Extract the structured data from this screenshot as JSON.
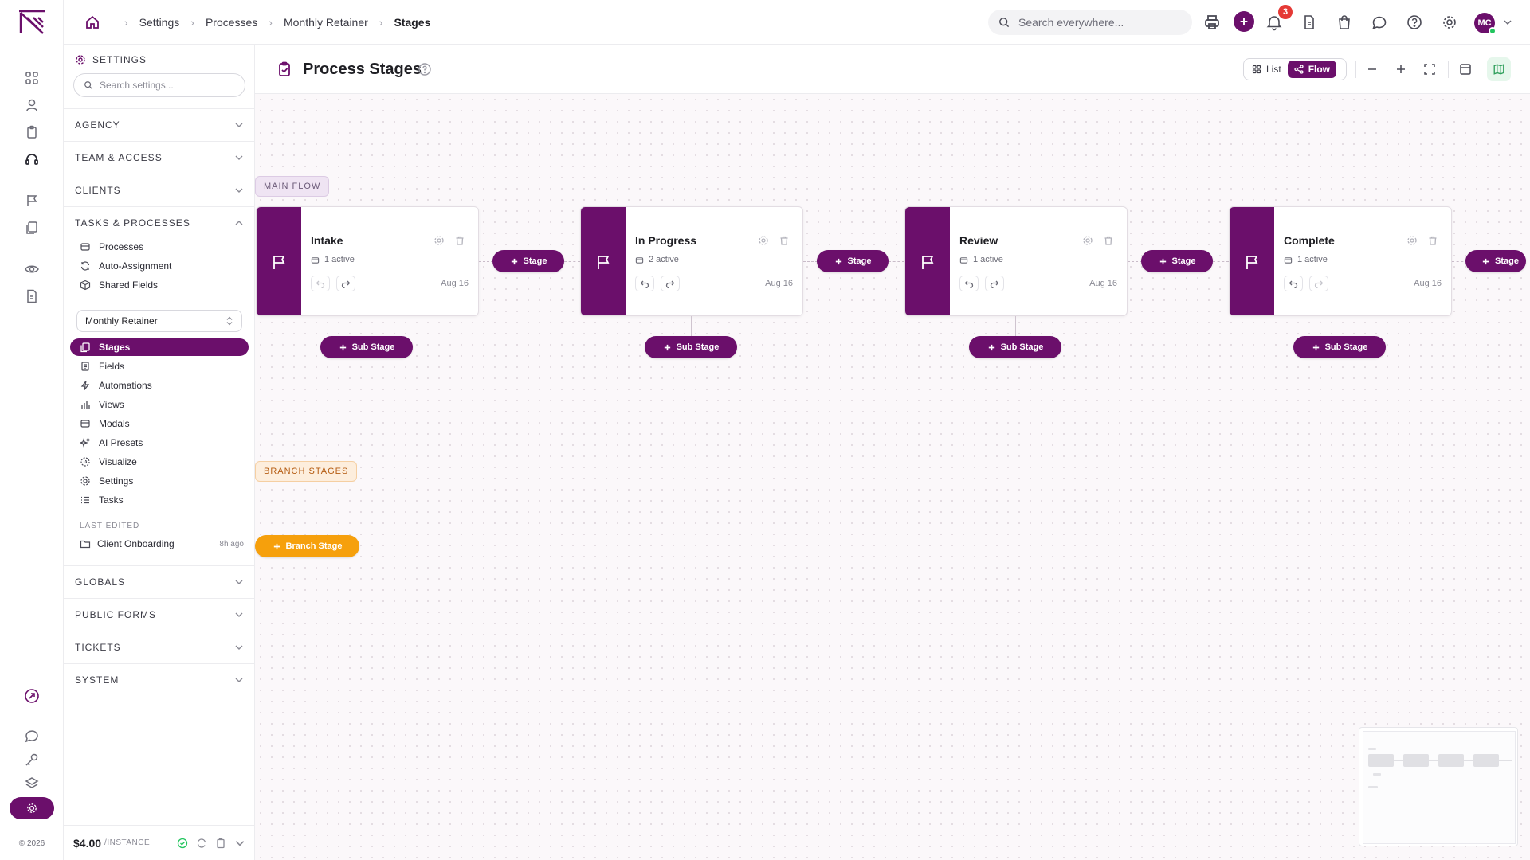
{
  "rail": {
    "copyright": "© 2026",
    "icons": [
      "grid-icon",
      "user-icon",
      "clipboard-icon",
      "headset-icon",
      "flag-icon",
      "process-icon",
      "eye-icon",
      "document-icon",
      "rocket-icon",
      "chat-icon",
      "key-icon",
      "layers-icon",
      "gear-icon"
    ]
  },
  "topbar": {
    "breadcrumb": [
      "Settings",
      "Processes",
      "Monthly Retainer",
      "Stages"
    ],
    "search_placeholder": "Search everywhere...",
    "notification_count": "3",
    "avatar_initials": "MC"
  },
  "sidebar": {
    "heading": "SETTINGS",
    "search_placeholder": "Search settings...",
    "sections_top": [
      "AGENCY",
      "TEAM & ACCESS",
      "CLIENTS"
    ],
    "tasks_section": "TASKS & PROCESSES",
    "tasks_items": [
      "Processes",
      "Auto-Assignment",
      "Shared Fields"
    ],
    "process_select": "Monthly Retainer",
    "process_items": [
      "Stages",
      "Fields",
      "Automations",
      "Views",
      "Modals",
      "AI Presets",
      "Visualize",
      "Settings",
      "Tasks"
    ],
    "last_edited_label": "LAST EDITED",
    "last_edited_item": "Client Onboarding",
    "last_edited_ago": "8h ago",
    "sections_bottom": [
      "GLOBALS",
      "PUBLIC FORMS",
      "TICKETS",
      "SYSTEM"
    ],
    "footer_price": "$4.00",
    "footer_unit": "/INSTANCE"
  },
  "main": {
    "title": "Process Stages",
    "view_list": "List",
    "view_flow": "Flow",
    "active_view": "Flow"
  },
  "canvas": {
    "main_flow_label": "MAIN FLOW",
    "branch_label": "BRANCH STAGES",
    "add_stage_label": "Stage",
    "add_sub_stage_label": "Sub Stage",
    "add_branch_label": "Branch Stage",
    "stages": [
      {
        "name": "Intake",
        "active": "1 active",
        "date": "Aug 16"
      },
      {
        "name": "In Progress",
        "active": "2 active",
        "date": "Aug 16"
      },
      {
        "name": "Review",
        "active": "1 active",
        "date": "Aug 16"
      },
      {
        "name": "Complete",
        "active": "1 active",
        "date": "Aug 16"
      }
    ]
  },
  "colors": {
    "brand": "#6b0f6b",
    "branch": "#f6a00c",
    "badge": "#e53935",
    "online": "#22c55e"
  }
}
